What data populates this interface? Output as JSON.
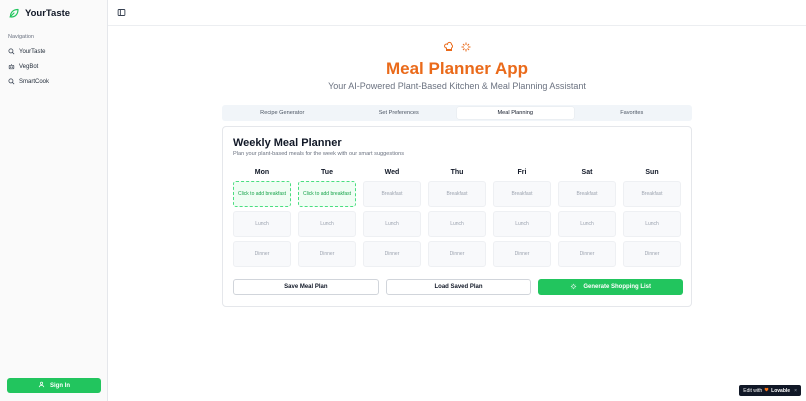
{
  "sidebar": {
    "brand": "YourTaste",
    "nav_heading": "Navigation",
    "items": [
      {
        "label": "YourTaste",
        "icon": "search-icon"
      },
      {
        "label": "VegBot",
        "icon": "bot-icon"
      },
      {
        "label": "SmartCook",
        "icon": "search-icon"
      }
    ],
    "signin_label": "Sign In"
  },
  "header": {
    "title": "Meal Planner App",
    "subtitle": "Your AI-Powered Plant-Based Kitchen & Meal Planning Assistant"
  },
  "tabs": [
    {
      "label": "Recipe Generator",
      "active": false
    },
    {
      "label": "Set Preferences",
      "active": false
    },
    {
      "label": "Meal Planning",
      "active": true
    },
    {
      "label": "Favorites",
      "active": false
    }
  ],
  "planner": {
    "title": "Weekly Meal Planner",
    "description": "Plan your plant-based meals for the week with our smart suggestions",
    "days": [
      "Mon",
      "Tue",
      "Wed",
      "Thu",
      "Fri",
      "Sat",
      "Sun"
    ],
    "rows": [
      [
        "Click to add breakfast",
        "Click to add breakfast",
        "Breakfast",
        "Breakfast",
        "Breakfast",
        "Breakfast",
        "Breakfast"
      ],
      [
        "Lunch",
        "Lunch",
        "Lunch",
        "Lunch",
        "Lunch",
        "Lunch",
        "Lunch"
      ],
      [
        "Dinner",
        "Dinner",
        "Dinner",
        "Dinner",
        "Dinner",
        "Dinner",
        "Dinner"
      ]
    ]
  },
  "actions": {
    "save": "Save Meal Plan",
    "load": "Load Saved Plan",
    "generate": "Generate Shopping List"
  },
  "badge": {
    "prefix": "Edit with",
    "brand": "Lovable",
    "close": "×"
  },
  "colors": {
    "accent": "#ea6a1a",
    "primary": "#22c55e"
  }
}
